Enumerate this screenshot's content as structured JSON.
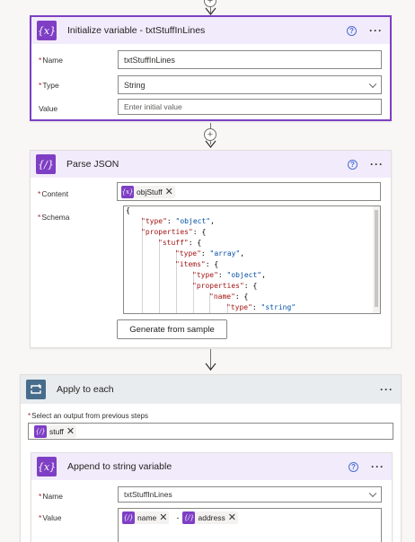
{
  "init_variable": {
    "title": "Initialize variable - txtStuffInLines",
    "name_label": "Name",
    "name_value": "txtStuffInLines",
    "type_label": "Type",
    "type_value": "String",
    "value_label": "Value",
    "value_placeholder": "Enter initial value"
  },
  "parse_json": {
    "title": "Parse JSON",
    "content_label": "Content",
    "content_token": "objStuff",
    "schema_label": "Schema",
    "schema_lines": [
      "{",
      "\"type\": \"object\",",
      "\"properties\": {",
      "\"stuff\": {",
      "\"type\": \"array\",",
      "\"items\": {",
      "\"type\": \"object\",",
      "\"properties\": {",
      "\"name\": {",
      "\"type\": \"string\""
    ],
    "generate_button": "Generate from sample"
  },
  "apply_to_each": {
    "title": "Apply to each",
    "select_label": "Select an output from previous steps",
    "select_token": "stuff"
  },
  "append_variable": {
    "title": "Append to string variable",
    "name_label": "Name",
    "name_value": "txtStuffInLines",
    "value_label": "Value",
    "value_token_1": "name",
    "value_separator": "-",
    "value_token_2": "address"
  },
  "icons": {
    "variable": "variable-icon",
    "parse": "data-operation-icon",
    "loop": "loop-icon",
    "help": "help-icon",
    "more": "more-options-icon",
    "add": "add-step-icon"
  },
  "colors": {
    "accent": "#7e3fc4",
    "loop": "#476c8c",
    "required": "#a4262c",
    "header_purple": "#f2ebfb",
    "header_grey": "#e9ecef"
  }
}
